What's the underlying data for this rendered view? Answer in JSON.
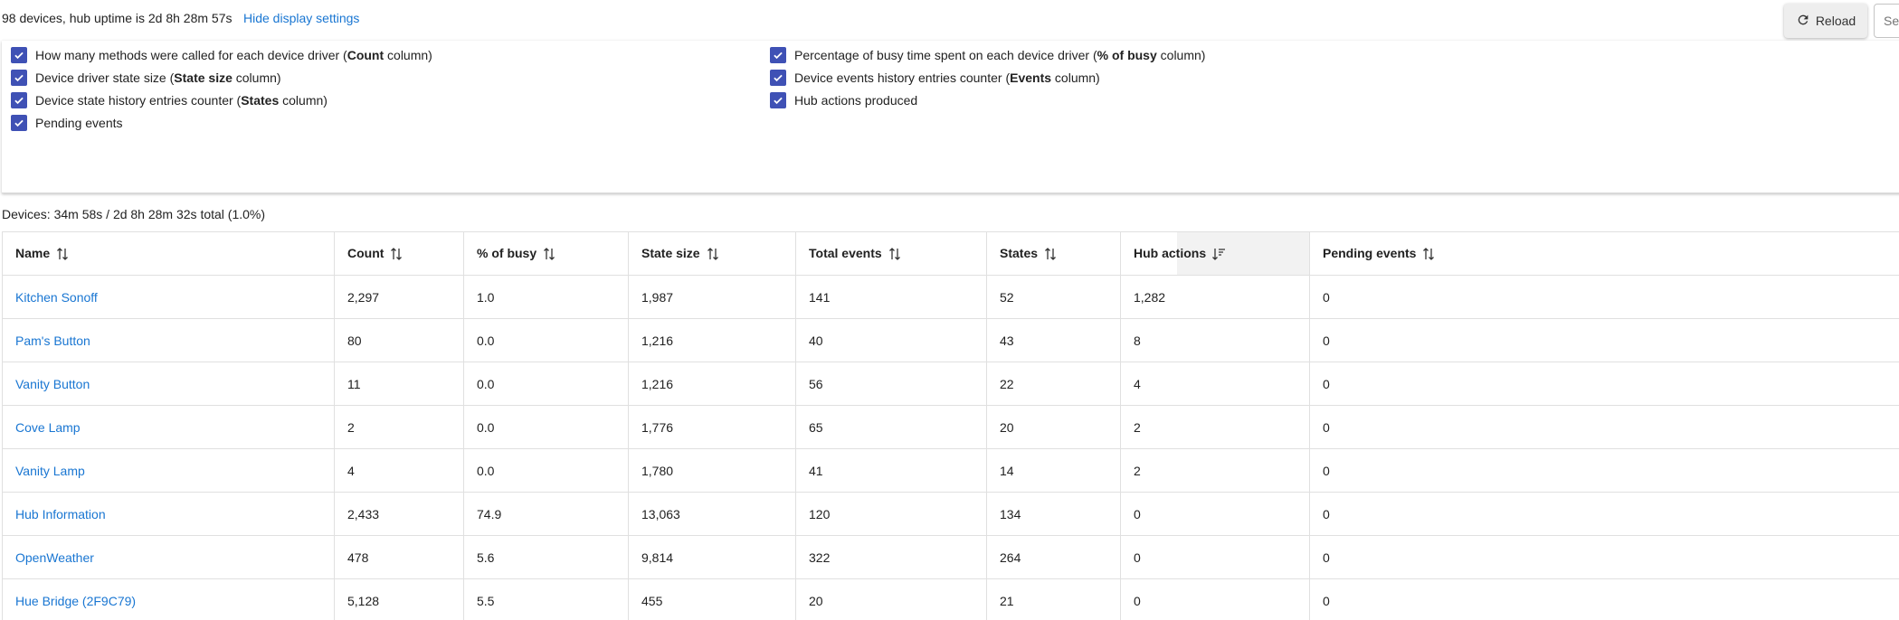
{
  "header": {
    "summary": "98 devices, hub uptime is 2d 8h 28m 57s",
    "toggle_link": "Hide display settings",
    "reload_label": "Reload",
    "search_placeholder": "Se"
  },
  "settings": {
    "left": [
      {
        "pre": "How many methods were called for each device driver (",
        "bold": "Count",
        "post": " column)"
      },
      {
        "pre": "Device driver state size (",
        "bold": "State size",
        "post": " column)"
      },
      {
        "pre": "Device state history entries counter (",
        "bold": "States",
        "post": " column)"
      },
      {
        "pre": "Pending events",
        "bold": "",
        "post": ""
      }
    ],
    "right": [
      {
        "pre": "Percentage of busy time spent on each device driver (",
        "bold": "% of busy",
        "post": " column)"
      },
      {
        "pre": "Device events history entries counter (",
        "bold": "Events",
        "post": " column)"
      },
      {
        "pre": "Hub actions produced",
        "bold": "",
        "post": ""
      }
    ],
    "checked": true,
    "checkbox_color": "#3f51b5"
  },
  "devices_total": "Devices: 34m 58s / 2d 8h 28m 32s total (1.0%)",
  "table": {
    "columns": [
      "Name",
      "Count",
      "% of busy",
      "State size",
      "Total events",
      "States",
      "Hub actions",
      "Pending events"
    ],
    "sorted_column": "Hub actions",
    "sort_direction": "descending",
    "rows": [
      [
        "Kitchen Sonoff",
        "2,297",
        "1.0",
        "1,987",
        "141",
        "52",
        "1,282",
        "0"
      ],
      [
        "Pam's Button",
        "80",
        "0.0",
        "1,216",
        "40",
        "43",
        "8",
        "0"
      ],
      [
        "Vanity Button",
        "11",
        "0.0",
        "1,216",
        "56",
        "22",
        "4",
        "0"
      ],
      [
        "Cove Lamp",
        "2",
        "0.0",
        "1,776",
        "65",
        "20",
        "2",
        "0"
      ],
      [
        "Vanity Lamp",
        "4",
        "0.0",
        "1,780",
        "41",
        "14",
        "2",
        "0"
      ],
      [
        "Hub Information",
        "2,433",
        "74.9",
        "13,063",
        "120",
        "134",
        "0",
        "0"
      ],
      [
        "OpenWeather",
        "478",
        "5.6",
        "9,814",
        "322",
        "264",
        "0",
        "0"
      ],
      [
        "Hue Bridge (2F9C79)",
        "5,128",
        "5.5",
        "455",
        "20",
        "21",
        "0",
        "0"
      ]
    ]
  },
  "colors": {
    "link": "#1976d2",
    "checkbox": "#3f51b5",
    "border": "#e0e0e0"
  }
}
